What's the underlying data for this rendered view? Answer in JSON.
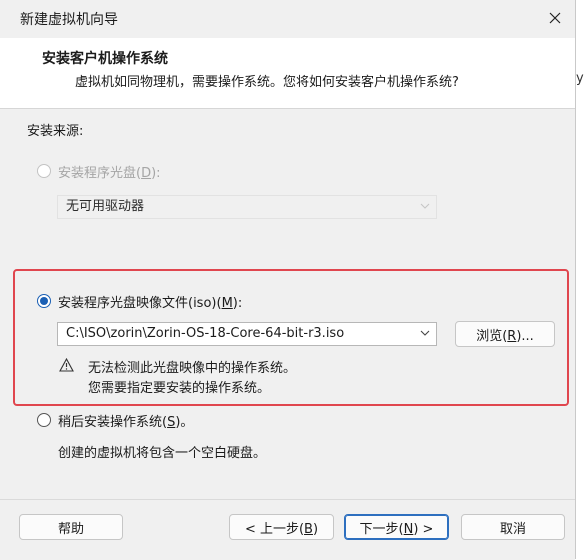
{
  "window": {
    "title": "新建虚拟机向导",
    "close_symbol": "✕"
  },
  "header": {
    "title": "安装客户机操作系统",
    "subtitle": "虚拟机如同物理机，需要操作系统。您将如何安装客户机操作系统?",
    "overflow_text": "y"
  },
  "source": {
    "section_label": "安装来源:",
    "disc": {
      "label": "安装程序光盘(",
      "key": "D",
      "label_end": "):",
      "selected": false,
      "enabled": false,
      "dropdown_value": "无可用驱动器"
    },
    "iso": {
      "label": "安装程序光盘映像文件(iso)(",
      "key": "M",
      "label_end": "):",
      "selected": true,
      "enabled": true,
      "path": "C:\\ISO\\zorin\\Zorin-OS-18-Core-64-bit-r3.iso",
      "browse": {
        "label": "浏览(",
        "key": "R",
        "label_end": ")..."
      },
      "warning": {
        "icon": "warning-icon",
        "line1": "无法检测此光盘映像中的操作系统。",
        "line2": "您需要指定要安装的操作系统。"
      }
    },
    "later": {
      "label": "稍后安装操作系统(",
      "key": "S",
      "label_end": ")。",
      "selected": false,
      "description": "创建的虚拟机将包含一个空白硬盘。"
    }
  },
  "footer": {
    "help_label": "帮助",
    "back": {
      "label": "< 上一步(",
      "key": "B",
      "label_end": ")"
    },
    "next": {
      "label": "下一步(",
      "key": "N",
      "label_end": ") >"
    },
    "cancel_label": "取消"
  },
  "colors": {
    "accent": "#1a5fb4",
    "highlight_box": "#e0464e"
  }
}
